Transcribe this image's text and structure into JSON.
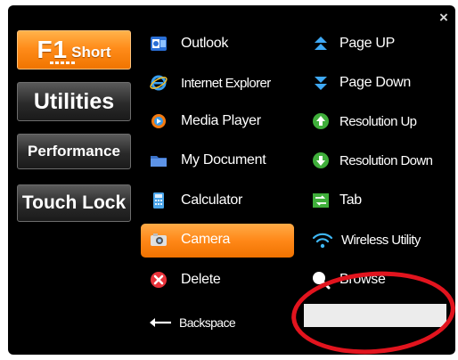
{
  "window": {
    "close_glyph": "×"
  },
  "modes": {
    "f1": {
      "main": "F1",
      "sub": "Short",
      "selected": true
    },
    "utilities": "Utilities",
    "performance": "Performance",
    "touch_lock": "Touch Lock"
  },
  "shortcuts": {
    "column1": [
      {
        "label": "Outlook",
        "icon": "outlook-icon"
      },
      {
        "label": "Internet Explorer",
        "icon": "internet-explorer-icon"
      },
      {
        "label": "Media Player",
        "icon": "media-player-icon"
      },
      {
        "label": "My Document",
        "icon": "folder-icon"
      },
      {
        "label": "Calculator",
        "icon": "calculator-icon"
      },
      {
        "label": "Camera",
        "icon": "camera-icon",
        "selected": true
      },
      {
        "label": "Delete",
        "icon": "delete-icon"
      },
      {
        "label": "Backspace",
        "icon": "left-arrow-icon"
      }
    ],
    "column2": [
      {
        "label": "Page UP",
        "icon": "page-up-icon"
      },
      {
        "label": "Page Down",
        "icon": "page-down-icon"
      },
      {
        "label": "Resolution Up",
        "icon": "resolution-up-icon"
      },
      {
        "label": "Resolution Down",
        "icon": "resolution-down-icon"
      },
      {
        "label": "Tab",
        "icon": "tab-icon"
      },
      {
        "label": "Wireless Utility",
        "icon": "wireless-icon"
      },
      {
        "label": "Browse",
        "icon": "browse-icon"
      }
    ]
  },
  "colors": {
    "accent_orange": "#ff8c1a",
    "panel_background": "#000000",
    "highlight_ring": "#e2141e"
  }
}
